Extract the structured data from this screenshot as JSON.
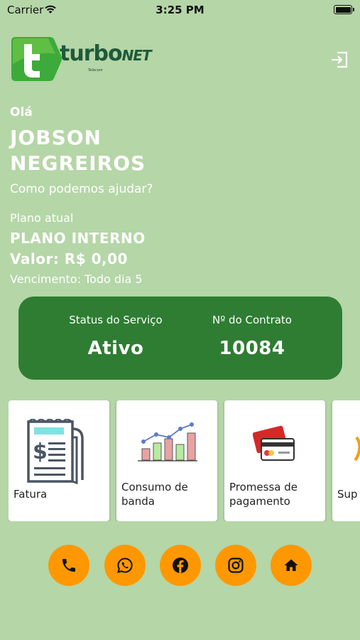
{
  "status_bar": {
    "carrier": "Carrier",
    "time": "3:25 PM"
  },
  "brand": {
    "logo_main": "turbo",
    "logo_suffix": "NET",
    "logo_tagline": "Telecom"
  },
  "greeting": {
    "hello": "Olá",
    "name": "JOBSON NEGREIROS",
    "help": "Como podemos ajudar?"
  },
  "plan": {
    "label": "Plano atual",
    "name": "PLANO INTERNO",
    "value": "Valor: R$ 0,00",
    "due": "Vencimento: Todo dia 5"
  },
  "service": {
    "status_label": "Status do Serviço",
    "status_value": "Ativo",
    "contract_label": "Nº do Contrato",
    "contract_value": "10084"
  },
  "tiles": [
    {
      "label": "Fatura",
      "icon": "invoice-icon"
    },
    {
      "label": "Consumo de banda",
      "icon": "bar-chart-icon"
    },
    {
      "label": "Promessa de pagamento",
      "icon": "credit-card-icon"
    },
    {
      "label": "Sup",
      "icon": "support-icon"
    }
  ],
  "social": [
    "phone-icon",
    "whatsapp-icon",
    "facebook-icon",
    "instagram-icon",
    "home-icon"
  ],
  "colors": {
    "background": "#b5d6a7",
    "service_card": "#2e7d32",
    "social_button": "#ff9800",
    "brand_green": "#1e5a3a"
  }
}
